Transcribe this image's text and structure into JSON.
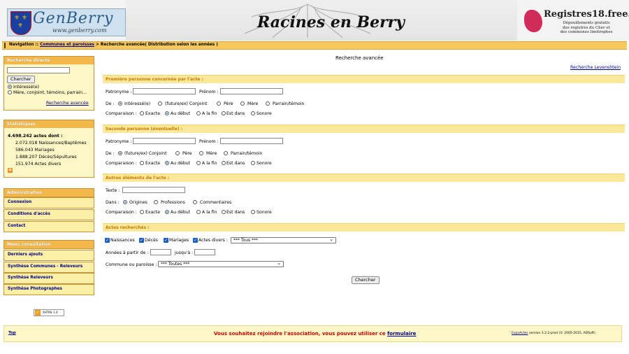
{
  "header": {
    "logo_title": "GenBerry",
    "logo_url": "www.genberry.com",
    "site_title": "Racines en Berry",
    "registres_title": "Registres18.free.fr",
    "registres_sub": [
      "Dépouillements gratuits",
      "des registres du Cher et",
      "des communes limitrophes"
    ]
  },
  "nav": {
    "prefix": "Navigation :: ",
    "link": "Communes et paroisses",
    "suffix": " > Recherche avancée( Distribution selon les années )"
  },
  "sidebar": {
    "direct": {
      "title": "Recherche directe",
      "search_button": "Chercher",
      "options": [
        "Intéressé(e)",
        "Mère, conjoint, témoins, parrain..."
      ],
      "advanced_link": "Recherche avancée"
    },
    "stats": {
      "title": "Statistiques",
      "total": "4.698.242 actes dont :",
      "lines": [
        "2.072.018 Naissances/Baptêmes",
        "586.043 Mariages",
        "1.888.207 Décès/Sépultures",
        "151.974 Actes divers"
      ]
    },
    "admin": {
      "title": "Administration",
      "items": [
        "Connexion",
        "Conditions d'accès",
        "Contact"
      ]
    },
    "menu": {
      "title": "Menu consultation",
      "items": [
        "Derniers ajouts",
        "Synthèse Communes - Releveurs",
        "Synthèse Releveurs",
        "Synthèse Photographes"
      ]
    },
    "badge": "XHTML 1.0"
  },
  "main": {
    "page_title": "Recherche avancée",
    "levenshtein_link": "Recherche Levenshtein",
    "section1": {
      "title": "Première personne concernée par l'acte :",
      "patronyme": "Patronyme :",
      "prenom": "Prénom :",
      "de_label": "De :",
      "de_options": [
        "Intéressé(e)",
        "(future/ex) Conjoint",
        "Père",
        "Mère",
        "Parrain/témoin"
      ],
      "comp_label": "Comparaison :",
      "comp_options": [
        "Exacte",
        "Au début",
        "A la fin",
        "Est dans",
        "Sonore"
      ]
    },
    "section2": {
      "title": "Seconde personne (éventuelle) :",
      "patronyme": "Patronyme :",
      "prenom": "Prénom :",
      "de_label": "De :",
      "de_options": [
        "(future/ex) Conjoint",
        "Père",
        "Mère",
        "Parrain/témoin"
      ],
      "comp_label": "Comparaison :",
      "comp_options": [
        "Exacte",
        "Au début",
        "A la fin",
        "Est dans",
        "Sonore"
      ]
    },
    "section3": {
      "title": "Autres éléments de l'acte :",
      "texte": "Texte :",
      "dans_label": "Dans :",
      "dans_options": [
        "Origines",
        "Professions",
        "Commentaires"
      ],
      "comp_label": "Comparaison :",
      "comp_options": [
        "Exacte",
        "Au début",
        "A la fin",
        "Est dans",
        "Sonore"
      ]
    },
    "section4": {
      "title": "Actes recherchés :",
      "types": [
        "Naissances",
        "Décès",
        "Mariages",
        "Actes divers :"
      ],
      "actes_divers_value": "*** Tous ***",
      "annees_label": "Années à partir de :",
      "jusqua_label": "jusqu'à :",
      "commune_label": "Commune ou paroisse :",
      "commune_value": "*** Toutes ***",
      "submit": "Chercher"
    }
  },
  "footer": {
    "top_link": "Top",
    "message": "Vous souhaitez rejoindre l'association, vous pouvez utiliser ce ",
    "message_link": "formulaire",
    "version_link": "ExpoActes",
    "version_text": " version 3.2.2-prod (© 2005-2015, ADSoft)"
  }
}
